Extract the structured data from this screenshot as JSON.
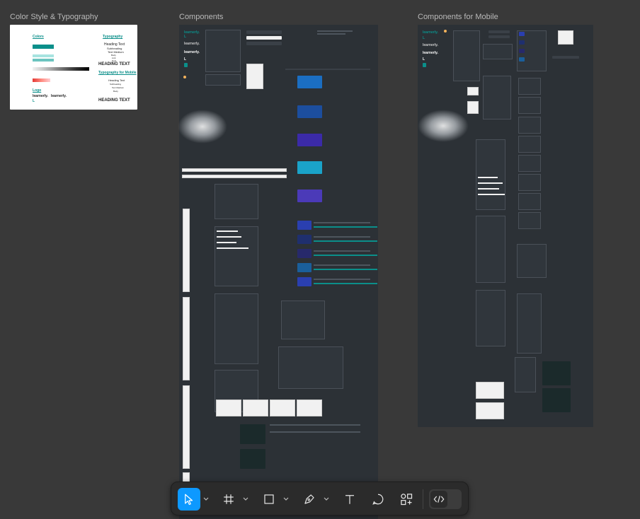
{
  "frames": [
    {
      "title": "Color Style & Typography"
    },
    {
      "title": "Components"
    },
    {
      "title": "Components for Mobile"
    }
  ],
  "color_frame": {
    "colors_heading": "Colors",
    "typography_heading": "Typography",
    "typography_mobile_heading": "Typography for Mobile",
    "heading_text": "HEADING TEXT",
    "heading_text_mobile": "HEADING TEXT",
    "logo_heading": "Logo",
    "brand": "learnerly.",
    "brand_short": "L",
    "accent": "#0b8f8a",
    "dark_teal": "#0a6b66",
    "danger": "#e53935",
    "heading_text_samples": [
      "Heading Text",
      "Subheading",
      "Text Medium",
      "Body",
      "Link",
      "Note"
    ],
    "heading_text_samples_mobile": [
      "Heading Text",
      "Subheading",
      "Text Medium",
      "Body"
    ]
  },
  "toolbar": {
    "tools": [
      {
        "name": "move-tool",
        "icon": "cursor-icon",
        "active": true
      },
      {
        "name": "frame-tool",
        "icon": "frame-icon",
        "active": false
      },
      {
        "name": "shape-tool",
        "icon": "rectangle-icon",
        "active": false
      },
      {
        "name": "pen-tool",
        "icon": "pen-icon",
        "active": false
      },
      {
        "name": "text-tool",
        "icon": "text-icon",
        "active": false
      },
      {
        "name": "comment-tool",
        "icon": "comment-icon",
        "active": false
      },
      {
        "name": "resources-tool",
        "icon": "components-icon",
        "active": false
      }
    ],
    "dev_mode_icon": "code-icon"
  },
  "ui_colors": {
    "canvas": "#393939",
    "frame_dark": "#2c3136",
    "active_tool": "#0d99ff"
  }
}
